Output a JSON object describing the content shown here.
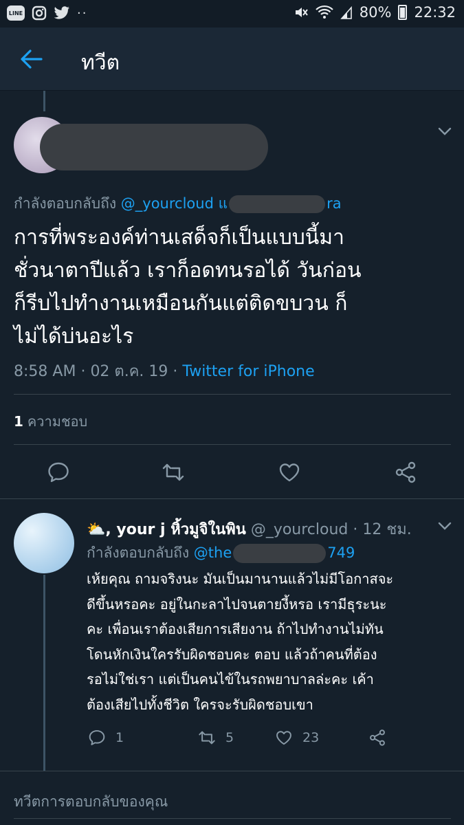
{
  "status_bar": {
    "app_icon_line": "LINE",
    "notification_dots": "··",
    "battery": "80%",
    "time": "22:32"
  },
  "header": {
    "title": "ทวีต"
  },
  "main_tweet": {
    "reply_prefix": "กำลังตอบกลับถึง",
    "reply_mention_start": "@_yourcloud แ",
    "reply_mention_end": "ra",
    "text_lines": [
      "การที่พระองค์ท่านเสด็จก็เป็นแบบนี้มา",
      "ชั่วนาตาปีแล้ว เราก็อดทนรอได้ วันก่อน",
      "ก็รีบไปทำงานเหมือนกันแต่ติดขบวน ก็",
      "ไม่ได้บ่นอะไร"
    ],
    "time": "8:58 AM",
    "date": "02 ต.ค. 19",
    "source": "Twitter for iPhone",
    "like_count": "1",
    "like_label": "ความชอบ"
  },
  "reply_tweet": {
    "display_name": "⛅, your j หิ้วมูจิในพิน",
    "handle": "@_yourcloud",
    "time_ago": "12 ชม.",
    "reply_prefix": "กำลังตอบกลับถึง",
    "reply_mention_start": "@the",
    "reply_mention_end": "749",
    "text_lines": [
      "เห้ยคุณ ถามจริงนะ มันเป็นมานานแล้วไม่มีโอกาสจะ",
      "ดีขึ้นหรอคะ อยู่ในกะลาไปจนตายงี้หรอ เรามีธุระนะ",
      "คะ เพื่อนเราต้องเสียการเสียงาน ถ้าไปทำงานไม่ทัน",
      "โดนหักเงินใครรับผิดชอบคะ ตอบ แล้วถ้าคนที่ต้อง",
      "รอไม่ใช่เรา แต่เป็นคนไข้ในรถพยาบาลล่ะคะ เค้า",
      "ต้องเสียไปทั้งชีวิต ใครจะรับผิดชอบเขา"
    ],
    "reply_count": "1",
    "retweet_count": "5",
    "like_count": "23"
  },
  "composer": {
    "placeholder": "ทวีตการตอบกลับของคุณ"
  },
  "colors": {
    "background": "#15202b",
    "accent": "#1da1f2",
    "muted": "#8899a6"
  }
}
